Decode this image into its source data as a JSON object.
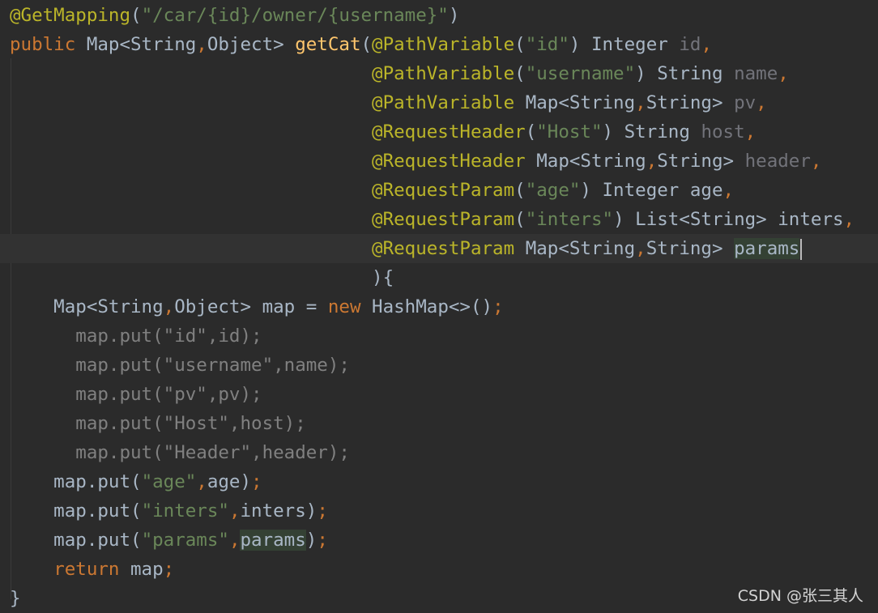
{
  "editor": {
    "lines": [
      [
        [
          "@GetMapping",
          "ann"
        ],
        [
          "(",
          "def"
        ],
        [
          "\"/car/{id}/owner/{username}\"",
          "str"
        ],
        [
          ")",
          "def"
        ]
      ],
      [
        [
          "public ",
          "kw"
        ],
        [
          "Map<String",
          "def"
        ],
        [
          ",",
          "kw"
        ],
        [
          "Object> ",
          "def"
        ],
        [
          "getCat",
          "fn"
        ],
        [
          "(",
          "def"
        ],
        [
          "@PathVariable",
          "ann"
        ],
        [
          "(",
          "def"
        ],
        [
          "\"id\"",
          "str"
        ],
        [
          ") Integer ",
          "def"
        ],
        [
          "id",
          "param-unused"
        ],
        [
          ",",
          "kw"
        ]
      ],
      [
        [
          "                                 ",
          "def"
        ],
        [
          "@PathVariable",
          "ann"
        ],
        [
          "(",
          "def"
        ],
        [
          "\"username\"",
          "str"
        ],
        [
          ") String ",
          "def"
        ],
        [
          "name",
          "param-unused"
        ],
        [
          ",",
          "kw"
        ]
      ],
      [
        [
          "                                 ",
          "def"
        ],
        [
          "@PathVariable ",
          "ann"
        ],
        [
          "Map<String",
          "def"
        ],
        [
          ",",
          "kw"
        ],
        [
          "String> ",
          "def"
        ],
        [
          "pv",
          "param-unused"
        ],
        [
          ",",
          "kw"
        ]
      ],
      [
        [
          "                                 ",
          "def"
        ],
        [
          "@RequestHeader",
          "ann"
        ],
        [
          "(",
          "def"
        ],
        [
          "\"Host\"",
          "str"
        ],
        [
          ") String ",
          "def"
        ],
        [
          "host",
          "param-unused"
        ],
        [
          ",",
          "kw"
        ]
      ],
      [
        [
          "                                 ",
          "def"
        ],
        [
          "@RequestHeader ",
          "ann"
        ],
        [
          "Map<String",
          "def"
        ],
        [
          ",",
          "kw"
        ],
        [
          "String> ",
          "def"
        ],
        [
          "header",
          "param-unused"
        ],
        [
          ",",
          "kw"
        ]
      ],
      [
        [
          "                                 ",
          "def"
        ],
        [
          "@RequestParam",
          "ann"
        ],
        [
          "(",
          "def"
        ],
        [
          "\"age\"",
          "str"
        ],
        [
          ") Integer age",
          "def"
        ],
        [
          ",",
          "kw"
        ]
      ],
      [
        [
          "                                 ",
          "def"
        ],
        [
          "@RequestParam",
          "ann"
        ],
        [
          "(",
          "def"
        ],
        [
          "\"inters\"",
          "str"
        ],
        [
          ") List<String> inters",
          "def"
        ],
        [
          ",",
          "kw"
        ]
      ],
      [
        [
          "                                 ",
          "def"
        ],
        [
          "@RequestParam ",
          "ann"
        ],
        [
          "Map<String",
          "def"
        ],
        [
          ",",
          "kw"
        ],
        [
          "String> ",
          "def"
        ],
        [
          "params",
          "hl"
        ]
      ],
      [
        [
          "                                 ",
          "def"
        ],
        [
          "){",
          "def"
        ]
      ],
      [
        [
          "    Map<String",
          "def"
        ],
        [
          ",",
          "kw"
        ],
        [
          "Object> map = ",
          "def"
        ],
        [
          "new ",
          "kw"
        ],
        [
          "HashMap<>()",
          "def"
        ],
        [
          ";",
          "kw"
        ]
      ],
      [
        [
          "      ",
          "def"
        ],
        [
          "map.put(\"id\",id);",
          "dim"
        ]
      ],
      [
        [
          "      ",
          "def"
        ],
        [
          "map.put(\"username\",name);",
          "dim"
        ]
      ],
      [
        [
          "      ",
          "def"
        ],
        [
          "map.put(\"pv\",pv);",
          "dim"
        ]
      ],
      [
        [
          "      ",
          "def"
        ],
        [
          "map.put(\"Host\",host);",
          "dim"
        ]
      ],
      [
        [
          "      ",
          "def"
        ],
        [
          "map.put(\"Header\",header);",
          "dim"
        ]
      ],
      [
        [
          "    map.put(",
          "def"
        ],
        [
          "\"age\"",
          "str"
        ],
        [
          ",",
          "kw"
        ],
        [
          "age)",
          "def"
        ],
        [
          ";",
          "kw"
        ]
      ],
      [
        [
          "    map.put(",
          "def"
        ],
        [
          "\"inters\"",
          "str"
        ],
        [
          ",",
          "kw"
        ],
        [
          "inters)",
          "def"
        ],
        [
          ";",
          "kw"
        ]
      ],
      [
        [
          "    map.put(",
          "def"
        ],
        [
          "\"params\"",
          "str"
        ],
        [
          ",",
          "kw"
        ],
        [
          "params",
          "hl"
        ],
        [
          ")",
          "def"
        ],
        [
          ";",
          "kw"
        ]
      ],
      [
        [
          "    ",
          "def"
        ],
        [
          "return ",
          "kw"
        ],
        [
          "map",
          "def"
        ],
        [
          ";",
          "kw"
        ]
      ],
      [
        [
          "}",
          "def"
        ]
      ]
    ],
    "current_line": 8,
    "caret_line": 8
  },
  "watermark": "CSDN @张三其人",
  "colors": {
    "background": "#2b2b2b",
    "current_line": "#323232",
    "keyword": "#cc7832",
    "annotation": "#bbb529",
    "string": "#6a8759",
    "method": "#ffc66d",
    "default": "#a9b7c6",
    "unused_param": "#72737a",
    "dimmed": "#808080",
    "usage_highlight": "#344134"
  }
}
